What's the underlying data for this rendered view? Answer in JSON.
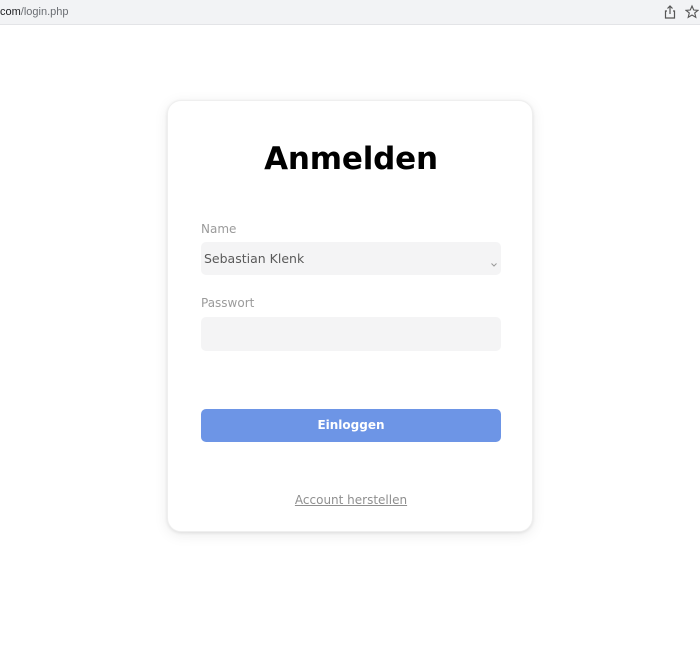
{
  "browser": {
    "url_domain": "com",
    "url_path": "/login.php",
    "share_icon": "share-icon",
    "star_icon": "bookmark-star-icon"
  },
  "login": {
    "title": "Anmelden",
    "name_label": "Name",
    "name_selected": "Sebastian Klenk",
    "password_label": "Passwort",
    "password_value": "",
    "submit_label": "Einloggen",
    "recover_link": "Account herstellen"
  },
  "colors": {
    "accent": "#6d95e6",
    "field_bg": "#f4f4f5",
    "label_text": "#9b9b9b"
  }
}
